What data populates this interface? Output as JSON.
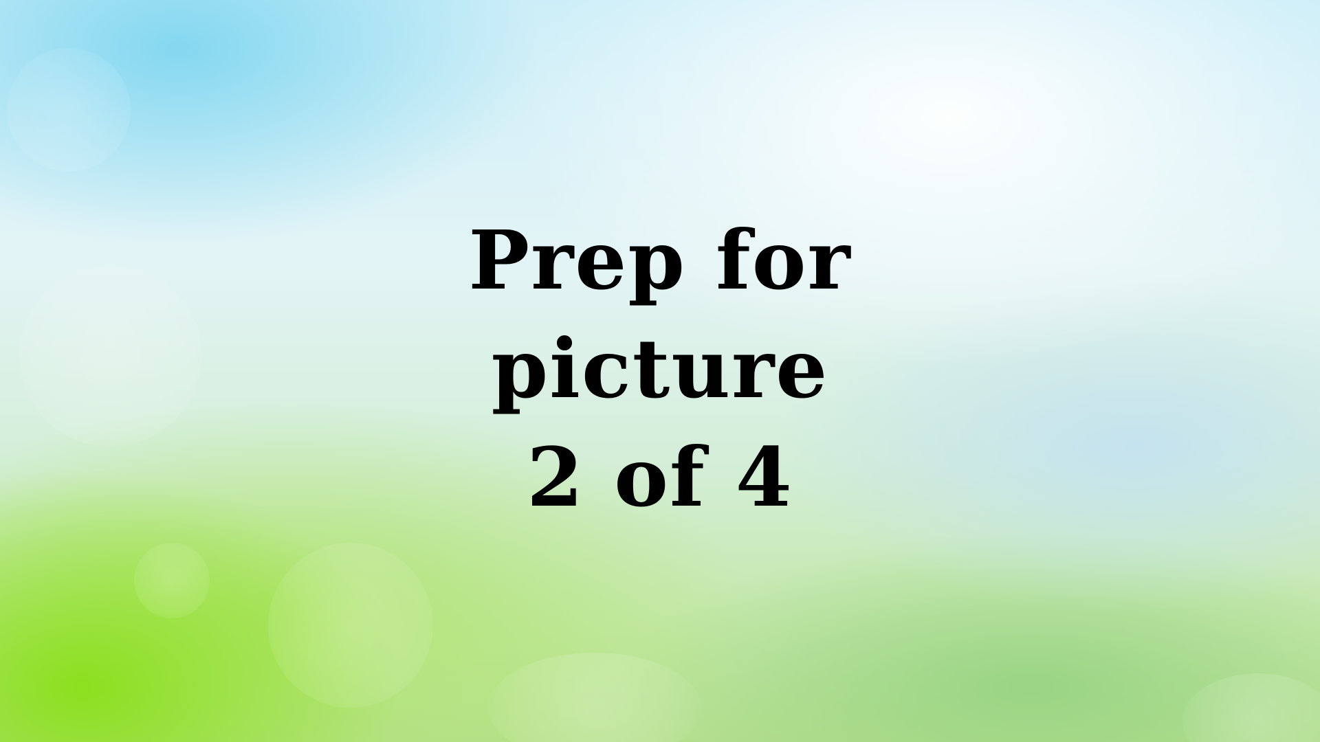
{
  "slide": {
    "title_lines": [
      "Prep for",
      "picture",
      "2 of 4"
    ],
    "text_color": "#000000",
    "background_colors": {
      "sky": "#cdeef8",
      "light": "#ffffff",
      "green": "#8ce01e"
    }
  }
}
